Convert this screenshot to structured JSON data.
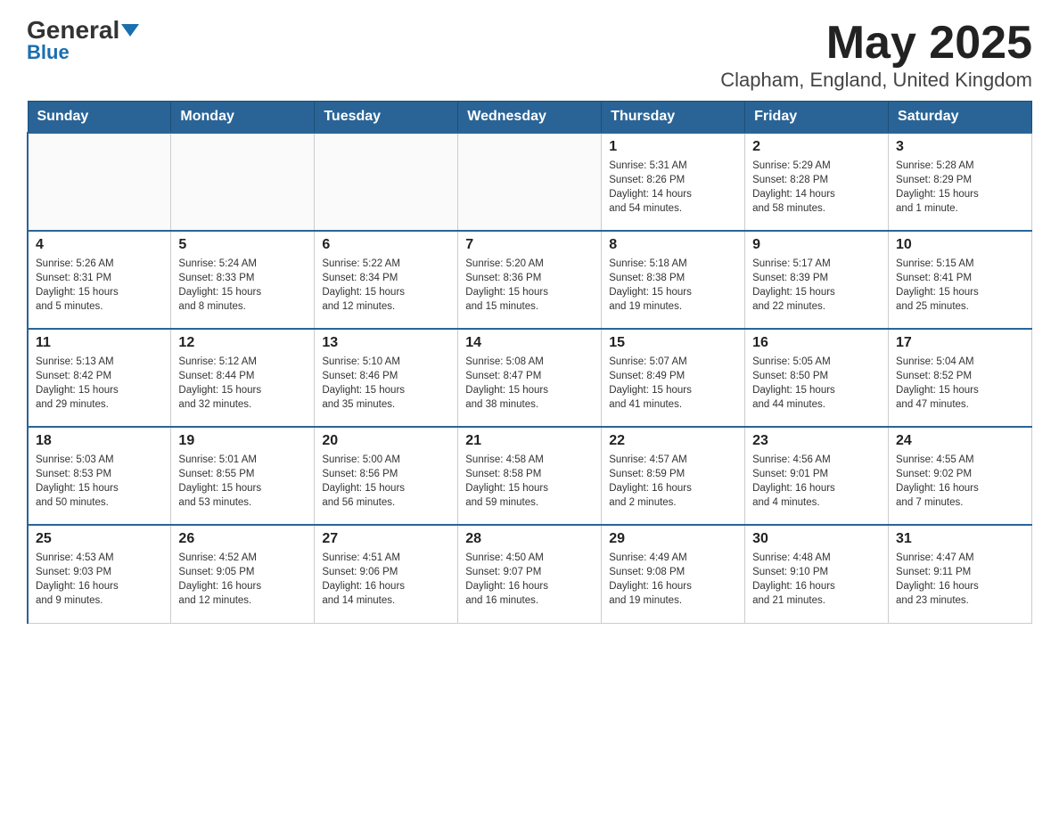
{
  "logo": {
    "brand1": "General",
    "brand2": "Blue"
  },
  "title": "May 2025",
  "subtitle": "Clapham, England, United Kingdom",
  "days_of_week": [
    "Sunday",
    "Monday",
    "Tuesday",
    "Wednesday",
    "Thursday",
    "Friday",
    "Saturday"
  ],
  "weeks": [
    [
      {
        "day": "",
        "info": ""
      },
      {
        "day": "",
        "info": ""
      },
      {
        "day": "",
        "info": ""
      },
      {
        "day": "",
        "info": ""
      },
      {
        "day": "1",
        "info": "Sunrise: 5:31 AM\nSunset: 8:26 PM\nDaylight: 14 hours\nand 54 minutes."
      },
      {
        "day": "2",
        "info": "Sunrise: 5:29 AM\nSunset: 8:28 PM\nDaylight: 14 hours\nand 58 minutes."
      },
      {
        "day": "3",
        "info": "Sunrise: 5:28 AM\nSunset: 8:29 PM\nDaylight: 15 hours\nand 1 minute."
      }
    ],
    [
      {
        "day": "4",
        "info": "Sunrise: 5:26 AM\nSunset: 8:31 PM\nDaylight: 15 hours\nand 5 minutes."
      },
      {
        "day": "5",
        "info": "Sunrise: 5:24 AM\nSunset: 8:33 PM\nDaylight: 15 hours\nand 8 minutes."
      },
      {
        "day": "6",
        "info": "Sunrise: 5:22 AM\nSunset: 8:34 PM\nDaylight: 15 hours\nand 12 minutes."
      },
      {
        "day": "7",
        "info": "Sunrise: 5:20 AM\nSunset: 8:36 PM\nDaylight: 15 hours\nand 15 minutes."
      },
      {
        "day": "8",
        "info": "Sunrise: 5:18 AM\nSunset: 8:38 PM\nDaylight: 15 hours\nand 19 minutes."
      },
      {
        "day": "9",
        "info": "Sunrise: 5:17 AM\nSunset: 8:39 PM\nDaylight: 15 hours\nand 22 minutes."
      },
      {
        "day": "10",
        "info": "Sunrise: 5:15 AM\nSunset: 8:41 PM\nDaylight: 15 hours\nand 25 minutes."
      }
    ],
    [
      {
        "day": "11",
        "info": "Sunrise: 5:13 AM\nSunset: 8:42 PM\nDaylight: 15 hours\nand 29 minutes."
      },
      {
        "day": "12",
        "info": "Sunrise: 5:12 AM\nSunset: 8:44 PM\nDaylight: 15 hours\nand 32 minutes."
      },
      {
        "day": "13",
        "info": "Sunrise: 5:10 AM\nSunset: 8:46 PM\nDaylight: 15 hours\nand 35 minutes."
      },
      {
        "day": "14",
        "info": "Sunrise: 5:08 AM\nSunset: 8:47 PM\nDaylight: 15 hours\nand 38 minutes."
      },
      {
        "day": "15",
        "info": "Sunrise: 5:07 AM\nSunset: 8:49 PM\nDaylight: 15 hours\nand 41 minutes."
      },
      {
        "day": "16",
        "info": "Sunrise: 5:05 AM\nSunset: 8:50 PM\nDaylight: 15 hours\nand 44 minutes."
      },
      {
        "day": "17",
        "info": "Sunrise: 5:04 AM\nSunset: 8:52 PM\nDaylight: 15 hours\nand 47 minutes."
      }
    ],
    [
      {
        "day": "18",
        "info": "Sunrise: 5:03 AM\nSunset: 8:53 PM\nDaylight: 15 hours\nand 50 minutes."
      },
      {
        "day": "19",
        "info": "Sunrise: 5:01 AM\nSunset: 8:55 PM\nDaylight: 15 hours\nand 53 minutes."
      },
      {
        "day": "20",
        "info": "Sunrise: 5:00 AM\nSunset: 8:56 PM\nDaylight: 15 hours\nand 56 minutes."
      },
      {
        "day": "21",
        "info": "Sunrise: 4:58 AM\nSunset: 8:58 PM\nDaylight: 15 hours\nand 59 minutes."
      },
      {
        "day": "22",
        "info": "Sunrise: 4:57 AM\nSunset: 8:59 PM\nDaylight: 16 hours\nand 2 minutes."
      },
      {
        "day": "23",
        "info": "Sunrise: 4:56 AM\nSunset: 9:01 PM\nDaylight: 16 hours\nand 4 minutes."
      },
      {
        "day": "24",
        "info": "Sunrise: 4:55 AM\nSunset: 9:02 PM\nDaylight: 16 hours\nand 7 minutes."
      }
    ],
    [
      {
        "day": "25",
        "info": "Sunrise: 4:53 AM\nSunset: 9:03 PM\nDaylight: 16 hours\nand 9 minutes."
      },
      {
        "day": "26",
        "info": "Sunrise: 4:52 AM\nSunset: 9:05 PM\nDaylight: 16 hours\nand 12 minutes."
      },
      {
        "day": "27",
        "info": "Sunrise: 4:51 AM\nSunset: 9:06 PM\nDaylight: 16 hours\nand 14 minutes."
      },
      {
        "day": "28",
        "info": "Sunrise: 4:50 AM\nSunset: 9:07 PM\nDaylight: 16 hours\nand 16 minutes."
      },
      {
        "day": "29",
        "info": "Sunrise: 4:49 AM\nSunset: 9:08 PM\nDaylight: 16 hours\nand 19 minutes."
      },
      {
        "day": "30",
        "info": "Sunrise: 4:48 AM\nSunset: 9:10 PM\nDaylight: 16 hours\nand 21 minutes."
      },
      {
        "day": "31",
        "info": "Sunrise: 4:47 AM\nSunset: 9:11 PM\nDaylight: 16 hours\nand 23 minutes."
      }
    ]
  ]
}
